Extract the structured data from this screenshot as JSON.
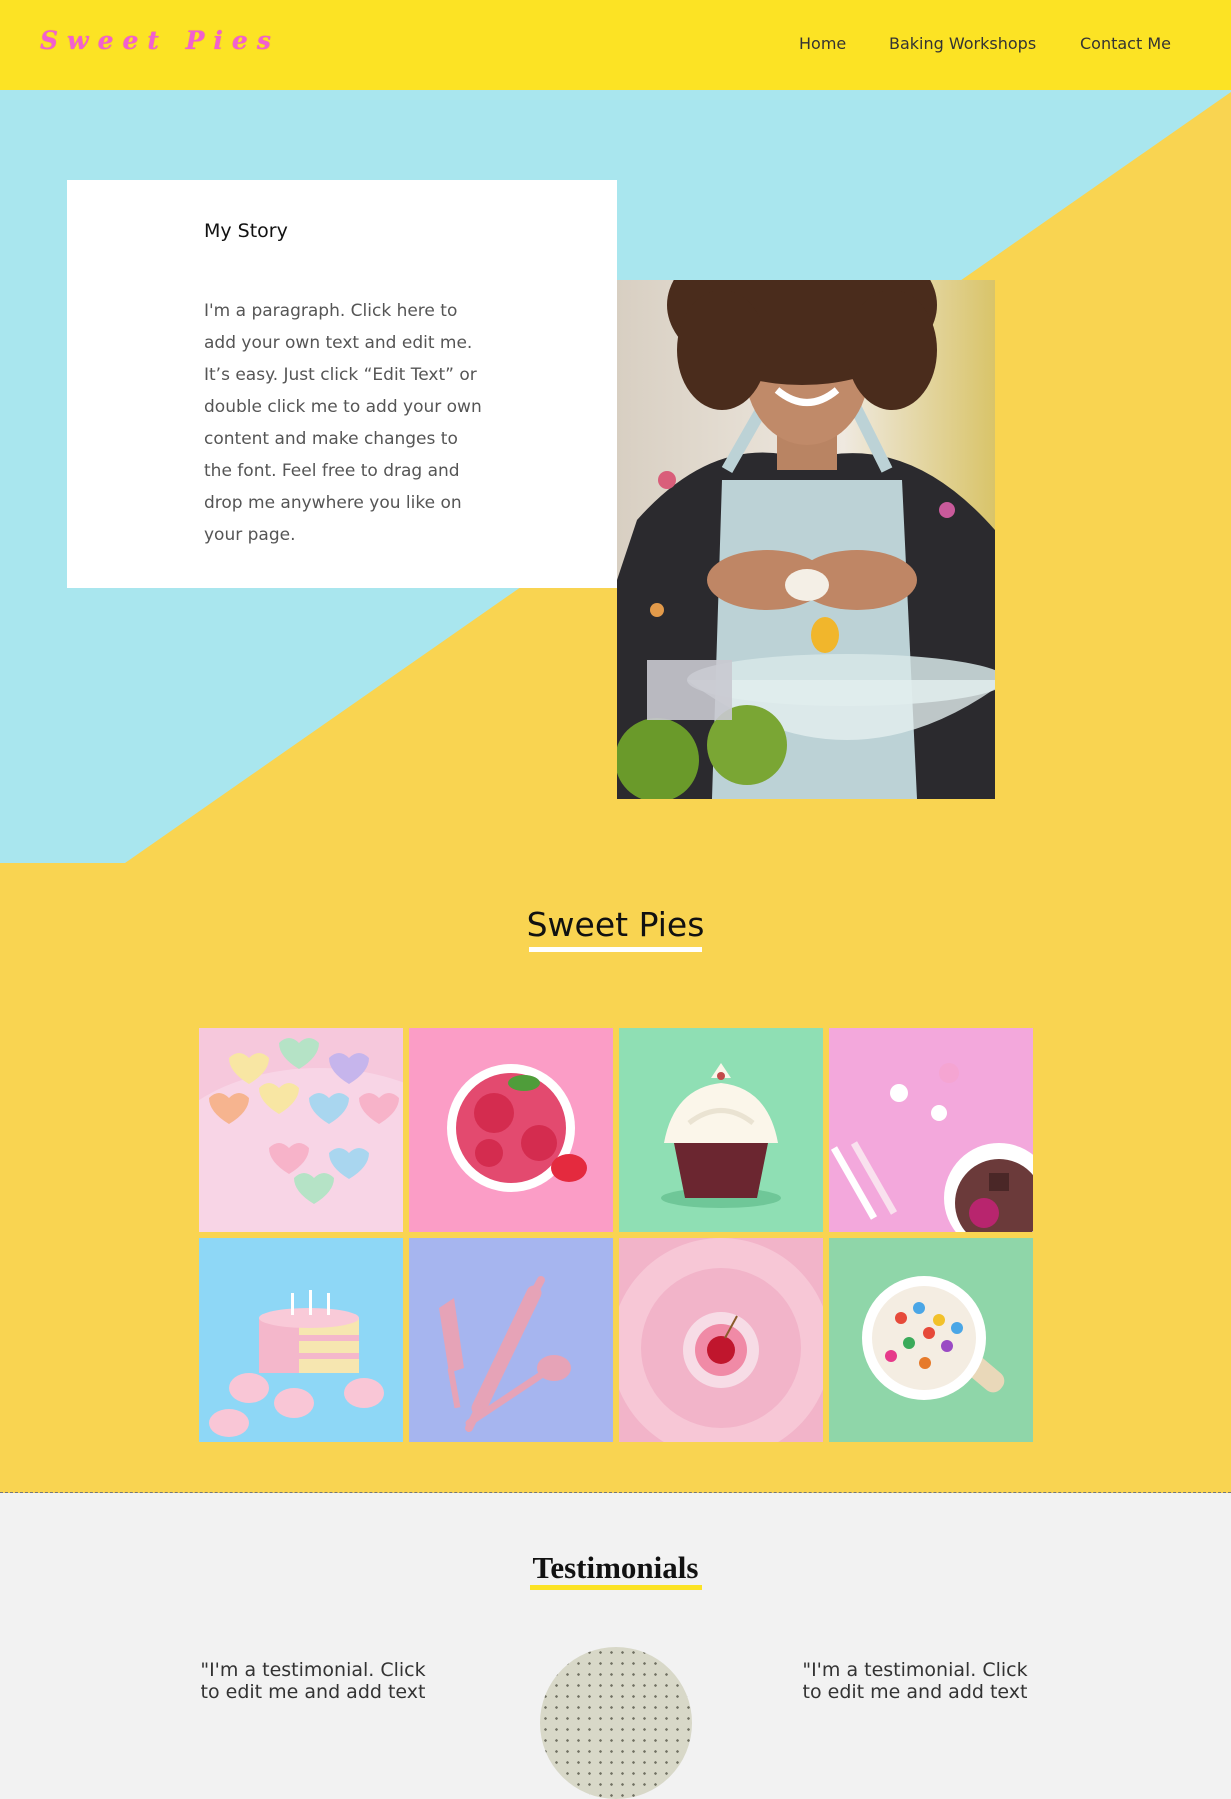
{
  "header": {
    "logo": "Sweet Pies",
    "nav": [
      "Home",
      "Baking Workshops",
      "Contact Me"
    ]
  },
  "story": {
    "title": "My Story",
    "paragraph": "I'm a paragraph. Click here to add your own text and edit me. It’s easy. Just click “Edit Text” or double click me to add your own content and make changes to the font. Feel free to drag and drop me anywhere you like on your page.",
    "photo_icon": "baker-photo-icon"
  },
  "gallery": {
    "title": "Sweet Pies",
    "tiles": [
      {
        "name": "candy-hearts",
        "bg": "#f6c8dc"
      },
      {
        "name": "strawberry-ice-cream",
        "bg": "#fb9dc6"
      },
      {
        "name": "cupcake",
        "bg": "#8fdfb4"
      },
      {
        "name": "meringues-and-straws",
        "bg": "#f3a8dc"
      },
      {
        "name": "birthday-cake",
        "bg": "#8ed7f6"
      },
      {
        "name": "baking-tools",
        "bg": "#a6b5ef"
      },
      {
        "name": "cherry-cupcake",
        "bg": "#f2b4c9"
      },
      {
        "name": "candy-ice-cream",
        "bg": "#8fd6a9"
      }
    ]
  },
  "testimonials": {
    "title": "Testimonials",
    "left": "\"I'm a testimonial. Click to edit me and add text",
    "right": "\"I'm a testimonial. Click to edit me and add text"
  },
  "colors": {
    "header": "#fce324",
    "sky": "#a9e6ee",
    "sun": "#f9d451",
    "logo": "#f25fd0"
  }
}
